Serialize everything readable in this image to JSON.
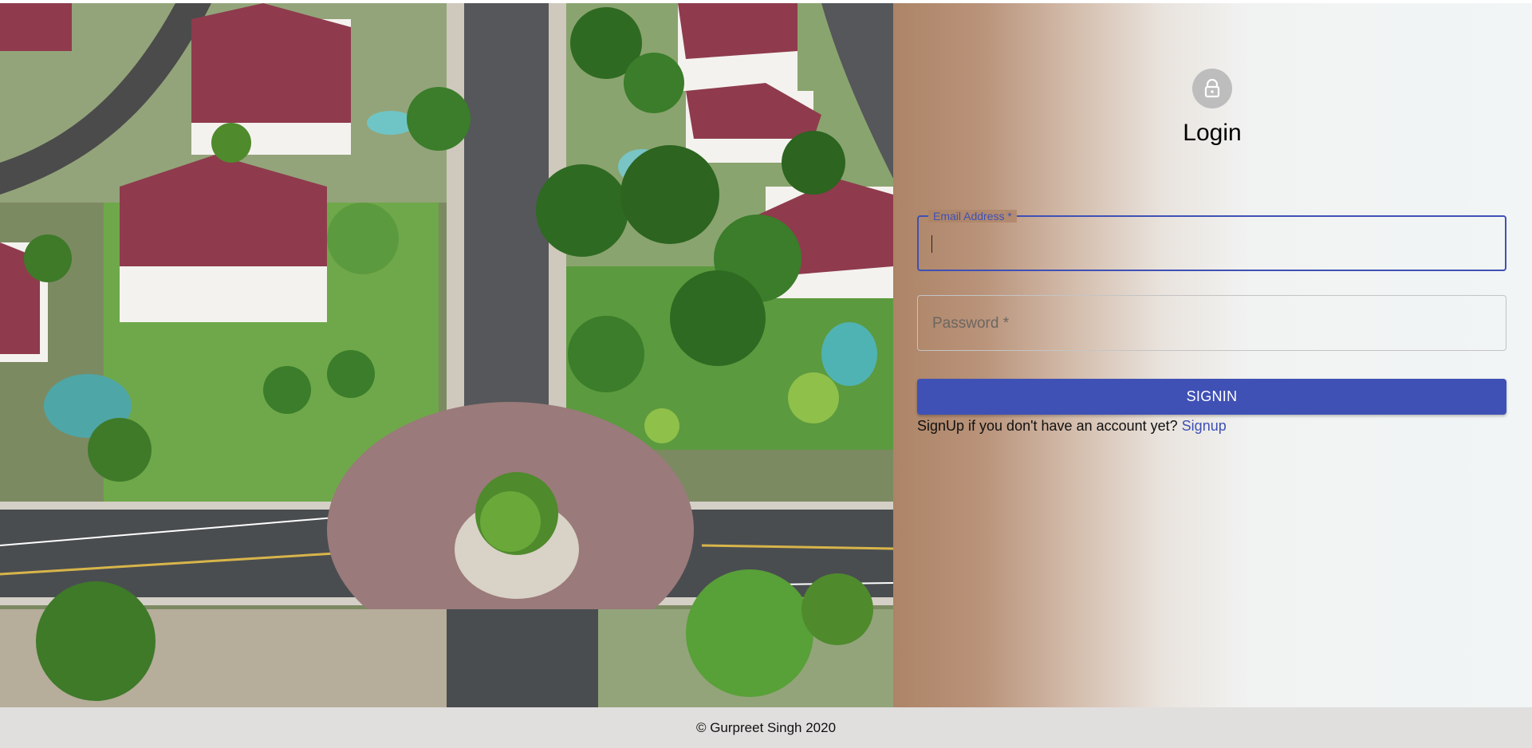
{
  "login": {
    "title": "Login",
    "email_label": "Email Address *",
    "password_placeholder": "Password *",
    "signin_label": "SIGNIN",
    "signup_prompt": "SignUp if you don't have an account yet?",
    "signup_link": "Signup",
    "lock_icon": "lock-icon"
  },
  "footer": {
    "copyright": "© Gurpreet Singh 2020"
  },
  "colors": {
    "primary": "#3f51b5",
    "panel_gradient_start": "#ad8466",
    "panel_gradient_end": "#f1f5f5",
    "footer_bg": "#e1dede"
  }
}
